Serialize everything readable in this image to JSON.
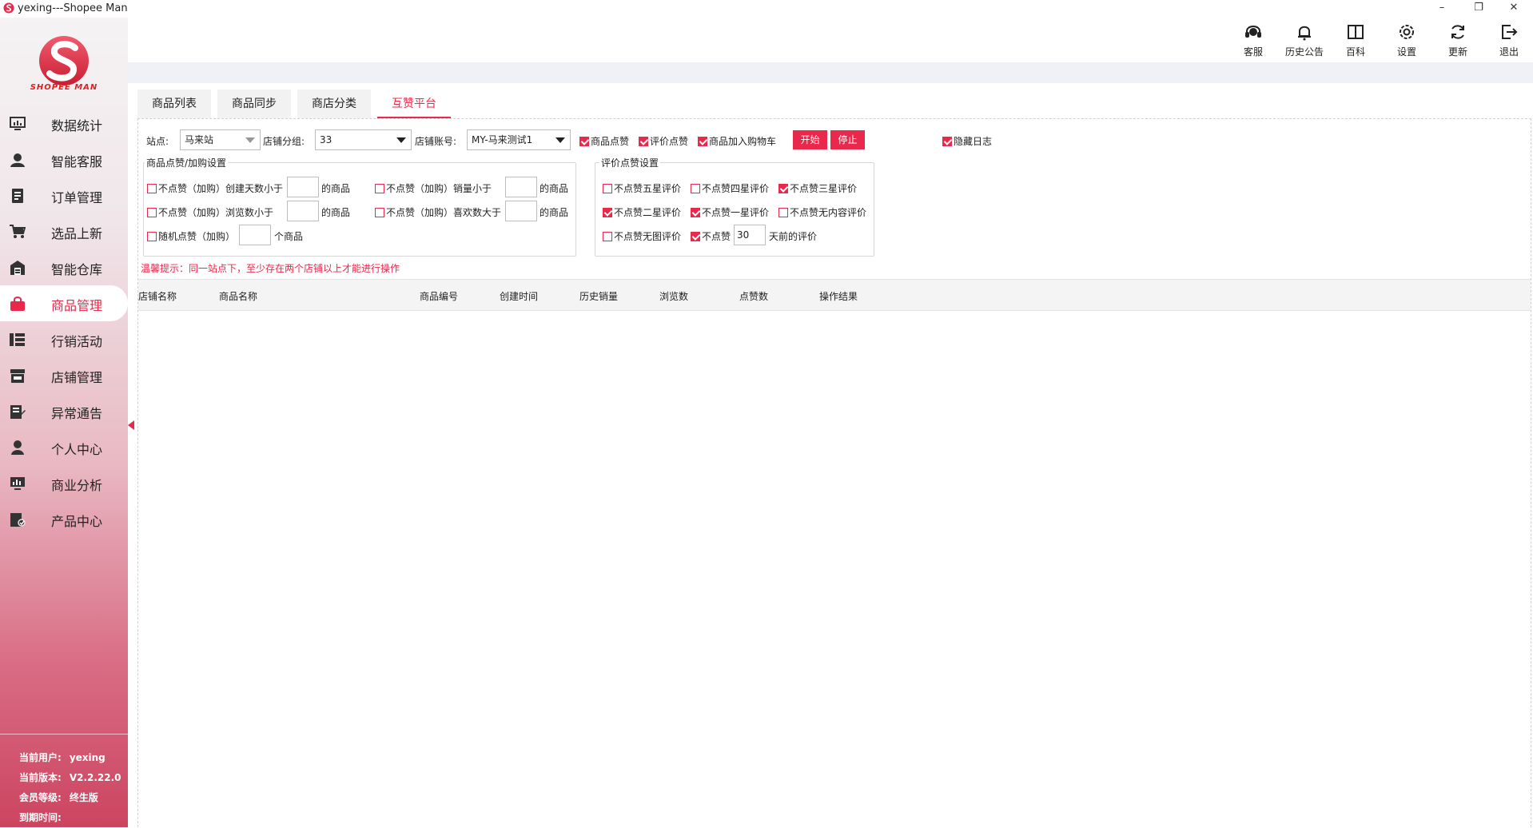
{
  "window": {
    "title": "yexing---Shopee Man",
    "minimize": "–",
    "maximize": "❐",
    "close": "✕"
  },
  "sidebar": {
    "logo_text": "SHOPEE MAN",
    "items": [
      {
        "label": "数据统计",
        "icon": "chart-monitor-icon"
      },
      {
        "label": "智能客服",
        "icon": "user-support-icon"
      },
      {
        "label": "订单管理",
        "icon": "document-icon"
      },
      {
        "label": "选品上新",
        "icon": "cart-icon"
      },
      {
        "label": "智能仓库",
        "icon": "warehouse-icon"
      },
      {
        "label": "商品管理",
        "icon": "bag-icon",
        "active": true
      },
      {
        "label": "行销活动",
        "icon": "list-icon"
      },
      {
        "label": "店铺管理",
        "icon": "store-icon"
      },
      {
        "label": "异常通告",
        "icon": "notice-icon"
      },
      {
        "label": "个人中心",
        "icon": "person-icon"
      },
      {
        "label": "商业分析",
        "icon": "analysis-icon"
      },
      {
        "label": "产品中心",
        "icon": "product-icon"
      }
    ],
    "user_info": {
      "user_label": "当前用户:",
      "user_value": "yexing",
      "version_label": "当前版本:",
      "version_value": "V2.2.22.0",
      "level_label": "会员等级:",
      "level_value": "终生版",
      "expire_label": "到期时间:",
      "expire_value": ""
    }
  },
  "toolbar": {
    "items": [
      {
        "label": "客服",
        "icon": "headset-icon"
      },
      {
        "label": "历史公告",
        "icon": "bell-icon"
      },
      {
        "label": "百科",
        "icon": "book-icon"
      },
      {
        "label": "设置",
        "icon": "gear-icon"
      },
      {
        "label": "更新",
        "icon": "refresh-icon"
      },
      {
        "label": "退出",
        "icon": "logout-icon"
      }
    ]
  },
  "tabs": [
    {
      "label": "商品列表"
    },
    {
      "label": "商品同步"
    },
    {
      "label": "商店分类"
    },
    {
      "label": "互赞平台",
      "active": true
    }
  ],
  "filters": {
    "site_label": "站点:",
    "site_value": "马来站",
    "group_label": "店铺分组:",
    "group_value": "33",
    "account_label": "店铺账号:",
    "account_value": "MY-马来测试1",
    "like_goods": "商品点赞",
    "like_review": "评价点赞",
    "add_cart": "商品加入购物车",
    "start_button": "开始",
    "stop_button": "停止",
    "hide_log": "隐藏日志"
  },
  "goods_settings": {
    "title": "商品点赞/加购设置",
    "row1a_label": "不点赞（加购）创建天数小于",
    "row1a_suffix": "的商品",
    "row1b_label": "不点赞（加购）销量小于",
    "row1b_suffix": "的商品",
    "row2a_label": "不点赞（加购）浏览数小于",
    "row2a_suffix": "的商品",
    "row2b_label": "不点赞（加购）喜欢数大于",
    "row2b_suffix": "的商品",
    "row3_label": "随机点赞（加购）",
    "row3_suffix": "个商品"
  },
  "review_settings": {
    "title": "评价点赞设置",
    "no_5star": "不点赞五星评价",
    "no_4star": "不点赞四星评价",
    "no_3star": "不点赞三星评价",
    "no_2star": "不点赞二星评价",
    "no_1star": "不点赞一星评价",
    "no_empty": "不点赞无内容评价",
    "no_noimg": "不点赞无图评价",
    "no_days_label": "不点赞",
    "days_value": "30",
    "days_suffix": "天前的评价"
  },
  "warning": "温馨提示：同一站点下，至少存在两个店铺以上才能进行操作",
  "table": {
    "columns": [
      "店铺名称",
      "商品名称",
      "商品编号",
      "创建时间",
      "历史销量",
      "浏览数",
      "点赞数",
      "操作结果"
    ]
  },
  "colors": {
    "accent": "#e8294b"
  }
}
